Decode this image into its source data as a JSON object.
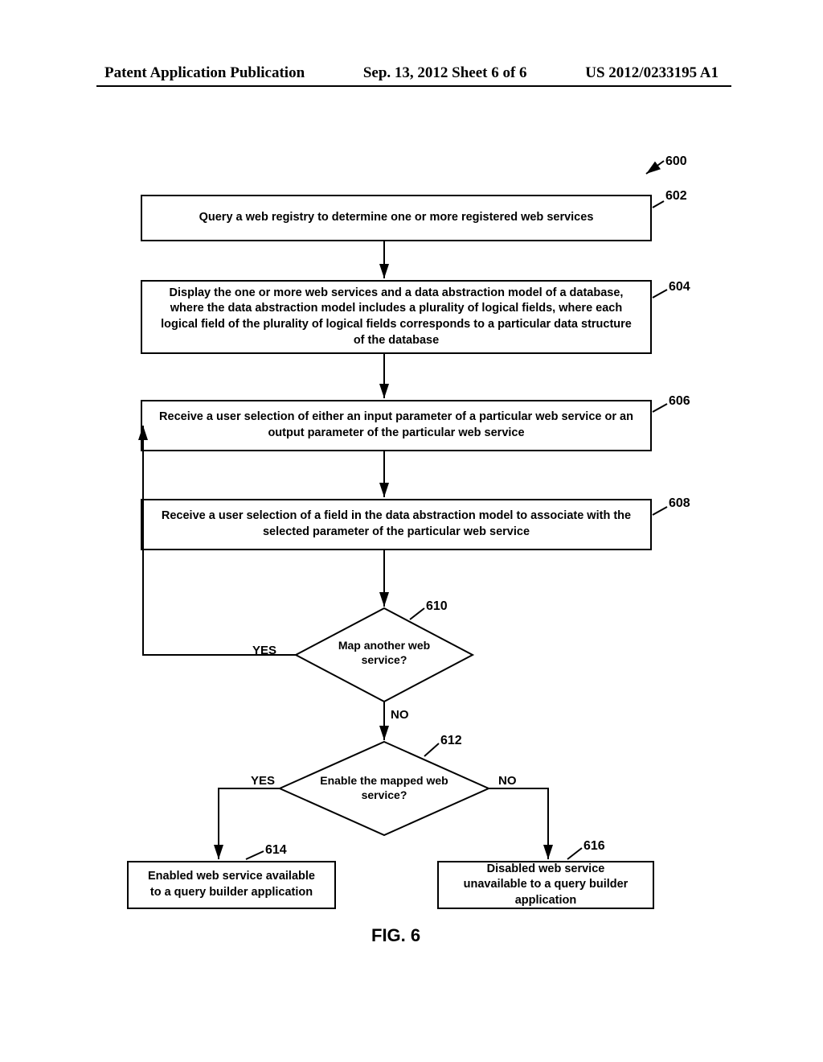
{
  "header": {
    "left": "Patent Application Publication",
    "center": "Sep. 13, 2012  Sheet 6 of 6",
    "right": "US 2012/0233195 A1"
  },
  "labels": {
    "n600": "600",
    "n602": "602",
    "n604": "604",
    "n606": "606",
    "n608": "608",
    "n610": "610",
    "n612": "612",
    "n614": "614",
    "n616": "616"
  },
  "boxes": {
    "b602": "Query a web registry to determine one or more registered web services",
    "b604": "Display the one or more web services and a data abstraction model of a database, where the data abstraction model includes a plurality of logical fields, where each logical field of the plurality of logical fields corresponds to a particular data structure of the database",
    "b606": "Receive a user selection of either an input parameter of a particular web service or an output parameter of the particular web service",
    "b608": "Receive a user selection of a field in the data abstraction model to associate with the selected parameter of the particular web service",
    "b614": "Enabled web service available to a query builder application",
    "b616": "Disabled web service unavailable to a query builder application"
  },
  "diamonds": {
    "d610": "Map another web service?",
    "d612": "Enable the mapped web service?"
  },
  "words": {
    "yes": "YES",
    "no": "NO"
  },
  "figure": "FIG. 6"
}
